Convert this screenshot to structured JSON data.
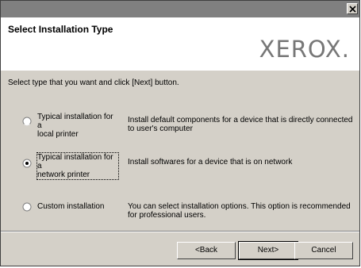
{
  "header": {
    "title": "Select Installation Type",
    "logo": "XEROX."
  },
  "instruction": "Select type that you want and click [Next] button.",
  "options": [
    {
      "label_line1": "Typical installation for a",
      "label_line2": "local printer",
      "description": "Install default components for a device that is directly connected to user's computer",
      "selected": false
    },
    {
      "label_line1": "Typical installation for a",
      "label_line2": "network printer",
      "description": "Install softwares for a device that is on network",
      "selected": true
    },
    {
      "label_line1": "Custom installation",
      "label_line2": "",
      "description": "You can select installation options. This option is recommended for professional users.",
      "selected": false
    }
  ],
  "buttons": {
    "back": "<Back",
    "next": "Next>",
    "cancel": "Cancel"
  },
  "icons": {
    "close": "close-icon",
    "radio": "radio-button"
  },
  "colors": {
    "titlebar": "#808080",
    "dialog": "#d4d0c8",
    "logo": "#777777"
  }
}
